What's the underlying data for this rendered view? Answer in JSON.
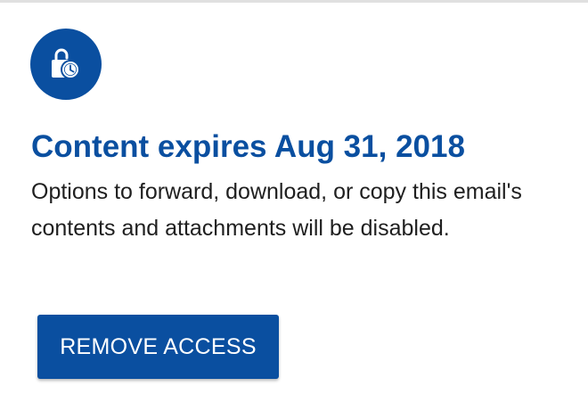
{
  "expiry_card": {
    "icon": "lock-clock-icon",
    "title": "Content expires Aug 31, 2018",
    "description": "Options to forward, download, or copy this email's contents and attachments will be disabled.",
    "remove_access_label": "REMOVE ACCESS"
  },
  "colors": {
    "accent": "#0a4fa0",
    "text": "#1f1f1f",
    "divider": "#e0e0e0"
  }
}
